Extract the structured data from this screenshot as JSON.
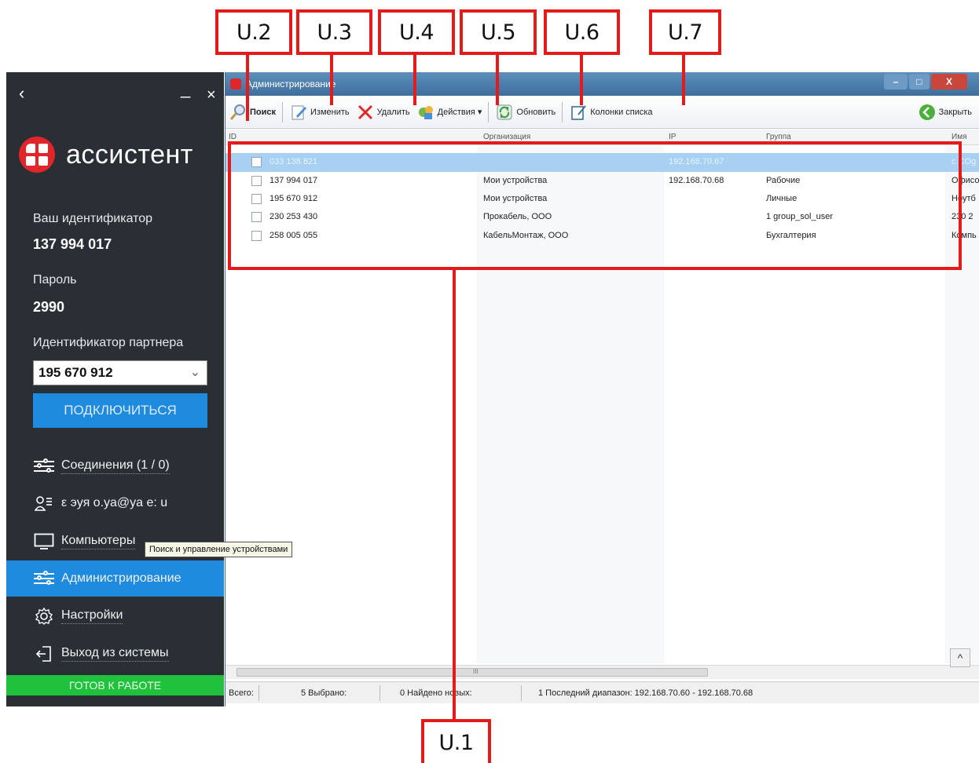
{
  "callouts": {
    "u2": "U.2",
    "u3": "U.3",
    "u4": "U.4",
    "u5": "U.5",
    "u6": "U.6",
    "u7": "U.7",
    "u1": "U.1"
  },
  "assistant": {
    "back_icon": "‹",
    "minimize_icon": "_",
    "close_icon": "×",
    "logo_text": "ассистент",
    "your_id_label": "Ваш идентификатор",
    "your_id_value": "137 994 017",
    "password_label": "Пароль",
    "password_value": "2990",
    "partner_label": "Идентификатор партнера",
    "partner_value": "195 670 912",
    "connect_label": "ПОДКЛЮЧИТЬСЯ",
    "nav": [
      {
        "label": "Соединения (1 / 0)",
        "icon": "sliders-icon"
      },
      {
        "label": "ε  эуя   o.ya@ya  e: u",
        "icon": "user-list-icon"
      },
      {
        "label": "Компьютеры",
        "icon": "monitor-icon"
      },
      {
        "label": "Администрирование",
        "icon": "sliders-icon",
        "active": true
      },
      {
        "label": "Настройки",
        "icon": "gear-icon"
      },
      {
        "label": "Выход из системы",
        "icon": "logout-icon"
      }
    ],
    "tooltip": "Поиск и управление устройствами",
    "status": "ГОТОВ К РАБОТЕ",
    "colors": {
      "panel_bg": "#2a2f35",
      "accent": "#1f8bde",
      "status": "#20c23d",
      "brand": "#e0262a"
    }
  },
  "window": {
    "title": "Администрирование",
    "controls": {
      "minimize": "–",
      "maximize": "□",
      "close": "X"
    },
    "toolbar": {
      "search": "Поиск",
      "edit": "Изменить",
      "delete": "Удалить",
      "actions": "Действия ▾",
      "refresh": "Обновить",
      "columns": "Колонки списка",
      "close": "Закрыть"
    },
    "columns": {
      "id": "ID",
      "org": "Организация",
      "ip": "IP",
      "group": "Группа",
      "name": "Имя"
    },
    "rows": [
      {
        "id": "033 138 821",
        "org": "",
        "ip": "192.168.70.67",
        "group": "",
        "name": "c.COg",
        "selected": true
      },
      {
        "id": "137 994 017",
        "org": "Мои устройства",
        "ip": "192.168.70.68",
        "group": "Рабочие",
        "name": "Офисо"
      },
      {
        "id": "195 670 912",
        "org": "Мои устройства",
        "ip": "",
        "group": "Личные",
        "name": "Ноутб"
      },
      {
        "id": "230 253 430",
        "org": "Прокабель, ООО",
        "ip": "",
        "group": "1 group_sol_user",
        "name": "230 2"
      },
      {
        "id": "258 005 055",
        "org": "КабельМонтаж, ООО",
        "ip": "",
        "group": "Бухгалтерия",
        "name": "Компь"
      }
    ],
    "hscroll_marker": "III",
    "scroll_up": "^",
    "status": {
      "total": "Всего:",
      "total_value": "5 Выбрано:",
      "selected_value": "0 Найдено новых:",
      "range": "1 Последний диапазон: 192.168.70.60 - 192.168.70.68"
    }
  }
}
